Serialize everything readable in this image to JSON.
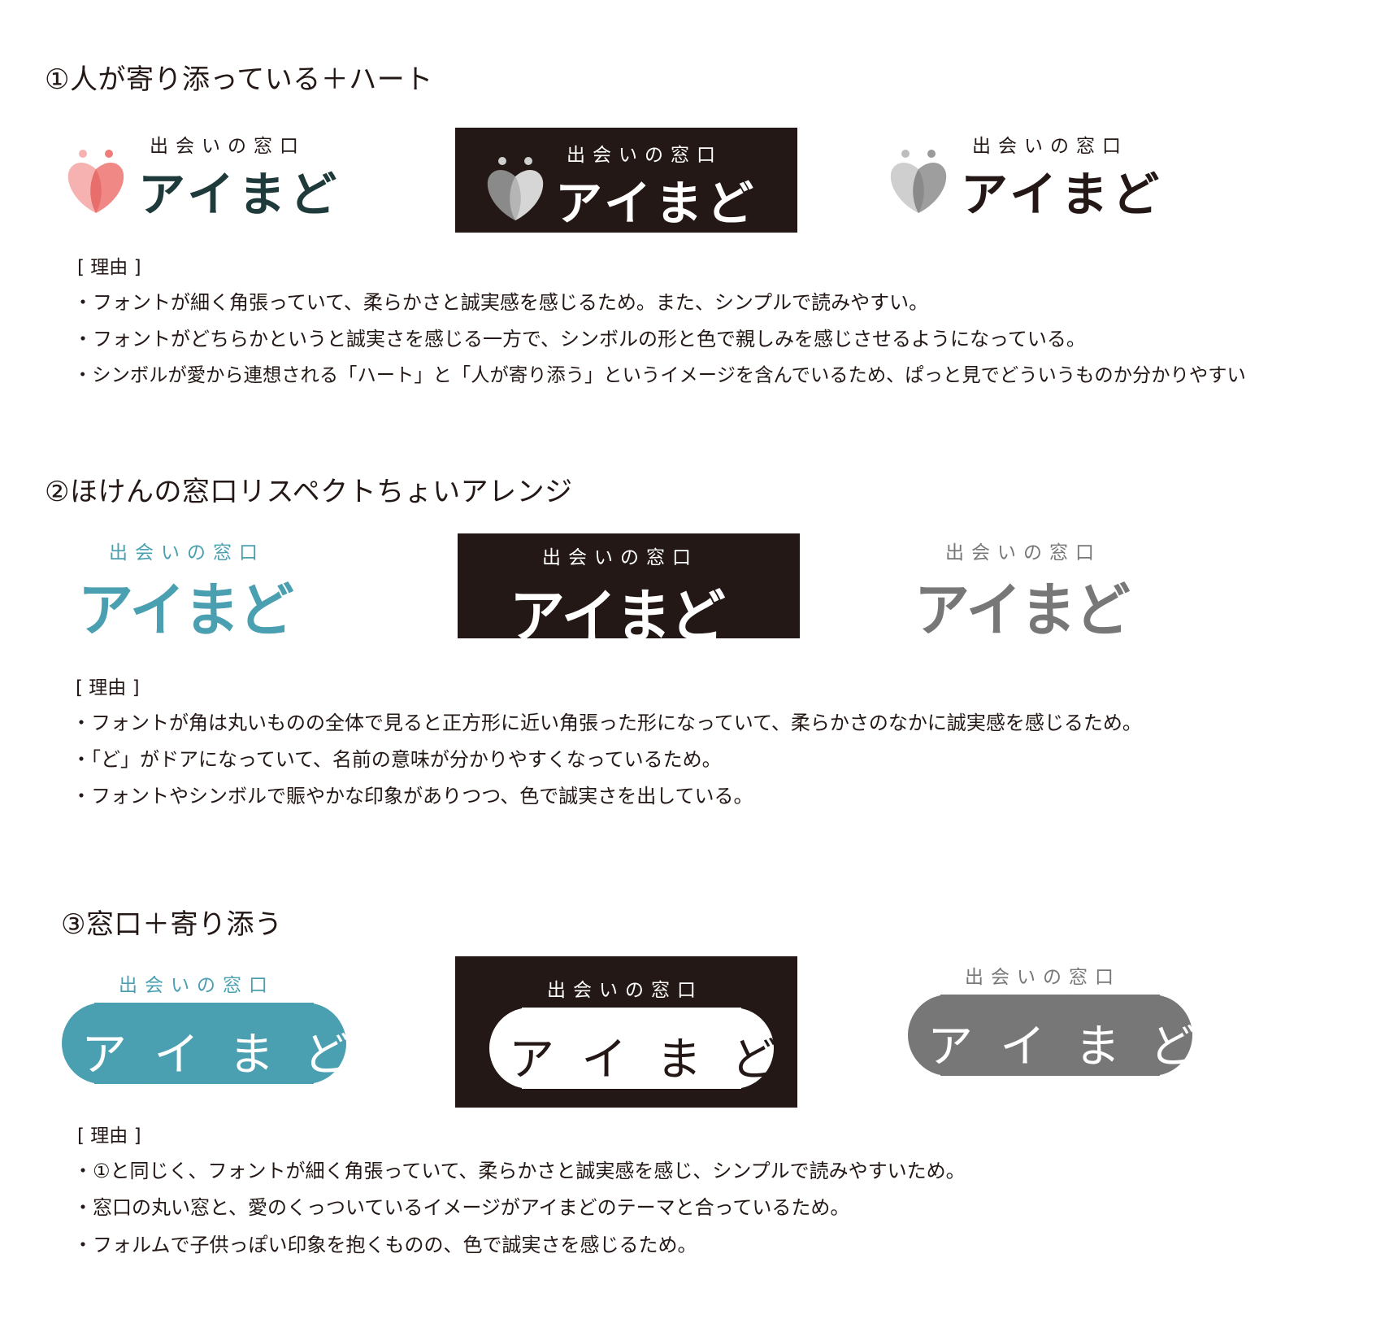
{
  "sections": [
    {
      "title": "①人が寄り添っている＋ハート",
      "logo": {
        "sub": "出会いの窓口",
        "main": "アイまど"
      },
      "reason_label": "[ 理由 ]",
      "reasons": [
        "・フォントが細く角張っていて、柔らかさと誠実感を感じるため。また、シンプルで読みやすい。",
        "・フォントがどちらかというと誠実さを感じる一方で、シンボルの形と色で親しみを感じさせるようになっている。",
        "・シンボルが愛から連想される「ハート」と「人が寄り添う」というイメージを含んでいるため、ぱっと見でどういうものか分かりやすい"
      ]
    },
    {
      "title": "②ほけんの窓口リスペクトちょいアレンジ",
      "logo": {
        "sub": "出会いの窓口",
        "main": "アイまど"
      },
      "reason_label": "[ 理由 ]",
      "reasons": [
        "・フォントが角は丸いものの全体で見ると正方形に近い角張った形になっていて、柔らかさのなかに誠実感を感じるため。",
        "・「ど」がドアになっていて、名前の意味が分かりやすくなっているため。",
        "・フォントやシンボルで賑やかな印象がありつつ、色で誠実さを出している。"
      ]
    },
    {
      "title": "③窓口＋寄り添う",
      "logo": {
        "sub": "出会いの窓口",
        "main": "アイまど"
      },
      "reason_label": "[ 理由 ]",
      "reasons": [
        "・①と同じく、フォントが細く角張っていて、柔らかさと誠実感を感じ、シンプルで読みやすいため。",
        "・窓口の丸い窓と、愛のくっついているイメージがアイまどのテーマと合っているため。",
        "・フォルムで子供っぽい印象を抱くものの、色で誠実さを感じるため。"
      ]
    }
  ],
  "colors": {
    "ink": "#231815",
    "coral_light": "#f5b2b0",
    "coral": "#ef7e7b",
    "teal": "#4a9fb1",
    "gray": "#777777",
    "light_gray": "#bdbdbd"
  }
}
